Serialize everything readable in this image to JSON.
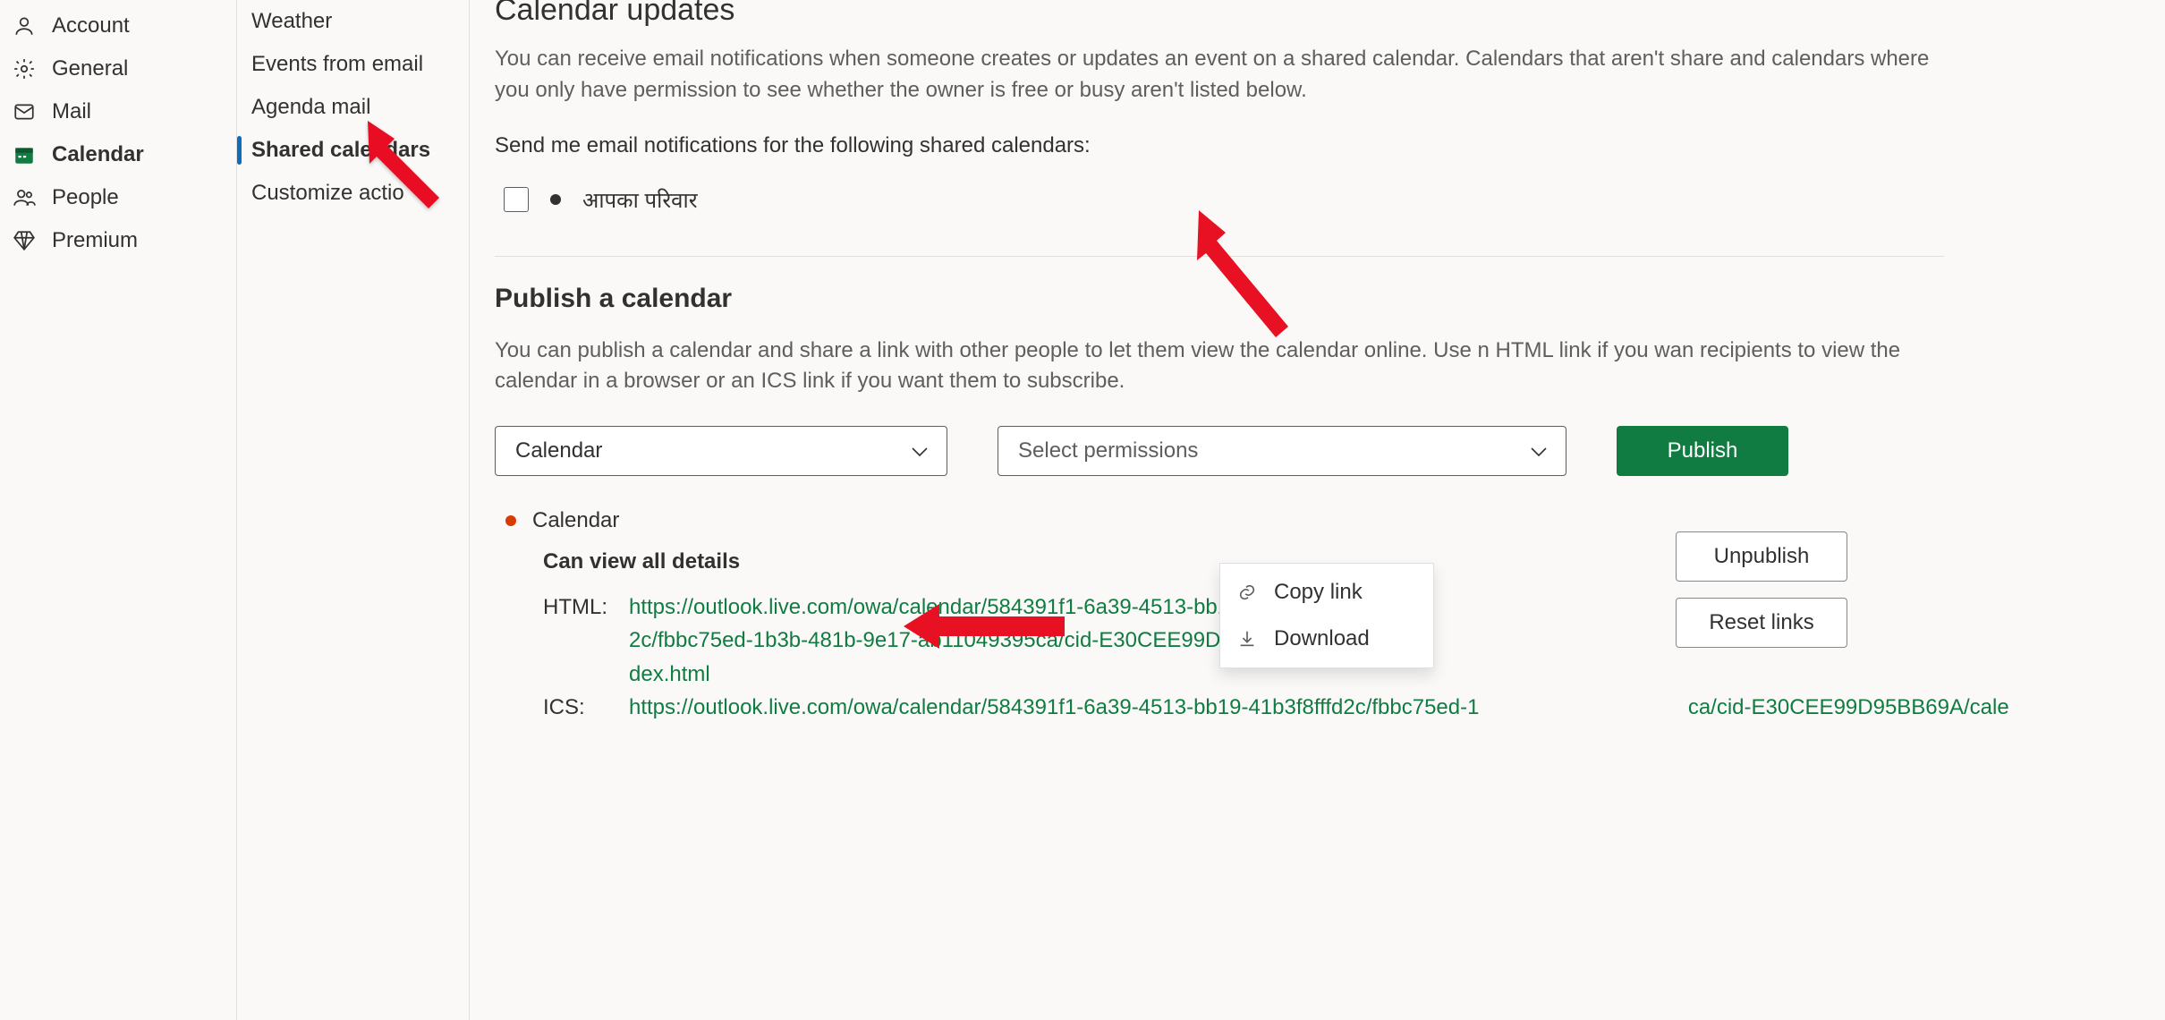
{
  "leftNav": {
    "items": [
      {
        "label": "Account",
        "icon": "person"
      },
      {
        "label": "General",
        "icon": "gear"
      },
      {
        "label": "Mail",
        "icon": "mail"
      },
      {
        "label": "Calendar",
        "icon": "calendar"
      },
      {
        "label": "People",
        "icon": "people"
      },
      {
        "label": "Premium",
        "icon": "diamond"
      }
    ],
    "activeIndex": 3
  },
  "secondaryNav": {
    "items": [
      {
        "label": "Weather"
      },
      {
        "label": "Events from email"
      },
      {
        "label": "Agenda mail"
      },
      {
        "label": "Shared calendars"
      },
      {
        "label": "Customize actio"
      }
    ],
    "activeIndex": 3
  },
  "updates": {
    "title": "Calendar updates",
    "description": "You can receive email notifications when someone creates or updates an event on a shared calendar. Calendars that aren't share and calendars where you only have permission to see whether the owner is free or busy aren't listed below.",
    "subhead": "Send me email notifications for the following shared calendars:",
    "calendarName": "आपका परिवार"
  },
  "publish": {
    "title": "Publish a calendar",
    "description": "You can publish a calendar and share a link with other people to let them view the calendar online. Use  n HTML link if you wan recipients to view the calendar in a browser or an ICS link if you want them to subscribe.",
    "selectCalendar": "Calendar",
    "selectPermissions": "Select permissions",
    "publishButton": "Publish",
    "published": {
      "calendarName": "Calendar",
      "permission": "Can view all details",
      "html": {
        "label": "HTML:",
        "url": "https://outlook.live.com/owa/calendar/584391f1-6a39-4513-bb19-41b3f8fffd2c/fbbc75ed-1b3b-481b-9e17-ab11049395ca/cid-E30CEE99D95BB69A/index.html"
      },
      "ics": {
        "label": "ICS:",
        "url": "https://outlook.live.com/owa/calendar/584391f1-6a39-4513-bb19-41b3f8fffd2c/fbbc75ed-1                                   ca/cid-E30CEE99D95BB69A/cale"
      },
      "unpublish": "Unpublish",
      "resetLinks": "Reset links"
    }
  },
  "contextMenu": {
    "copy": "Copy link",
    "download": "Download"
  },
  "colors": {
    "brandGreen": "#107c41",
    "accentOrange": "#d83b01",
    "arrowRed": "#e81123"
  }
}
